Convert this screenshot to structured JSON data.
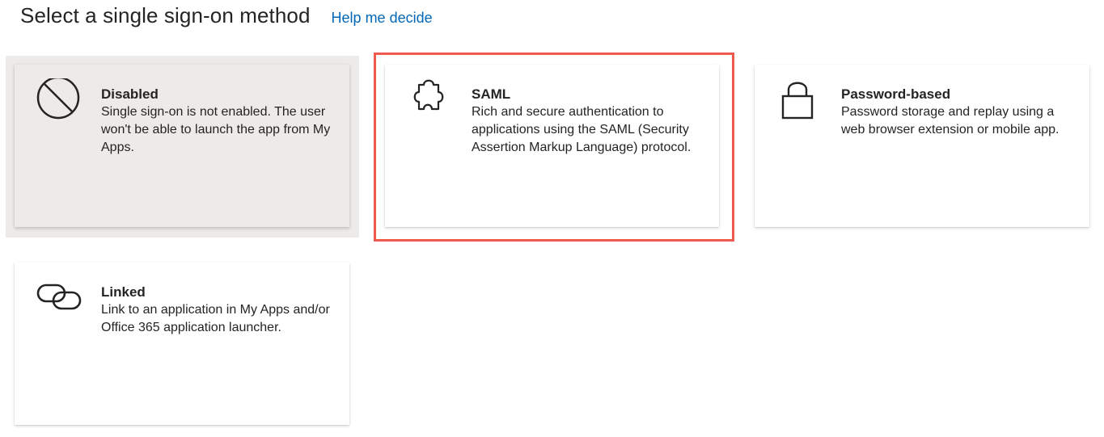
{
  "header": {
    "title": "Select a single sign-on method",
    "help_link": "Help me decide"
  },
  "methods": [
    {
      "title": "Disabled",
      "description": "Single sign-on is not enabled. The user won't be able to launch the app from My Apps.",
      "icon": "disabled-icon",
      "state": "current"
    },
    {
      "title": "SAML",
      "description": "Rich and secure authentication to applications using the SAML (Security Assertion Markup Language) protocol.",
      "icon": "puzzle-icon",
      "state": "highlighted"
    },
    {
      "title": "Password-based",
      "description": "Password storage and replay using a web browser extension or mobile app.",
      "icon": "lock-icon"
    },
    {
      "title": "Linked",
      "description": "Link to an application in My Apps and/or Office 365 application launcher.",
      "icon": "link-icon"
    }
  ],
  "colors": {
    "link": "#0067b8",
    "highlight": "#ef5b4e",
    "disabled_bg": "#edebe9"
  }
}
